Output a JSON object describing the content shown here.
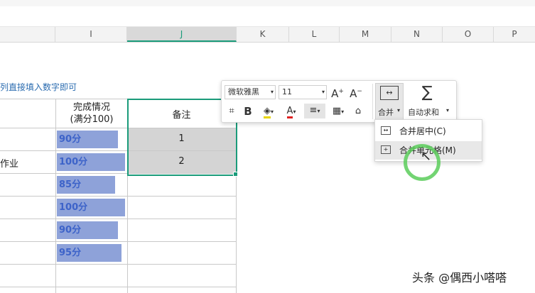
{
  "columns": [
    {
      "letter": "I",
      "selected": false
    },
    {
      "letter": "J",
      "selected": true
    },
    {
      "letter": "K",
      "selected": false
    },
    {
      "letter": "L",
      "selected": false
    },
    {
      "letter": "M",
      "selected": false
    },
    {
      "letter": "N",
      "selected": false
    },
    {
      "letter": "O",
      "selected": false
    },
    {
      "letter": "P",
      "selected": false
    }
  ],
  "sheet": {
    "note_text": "列直接填入数字即可",
    "header_completion": "完成情况\n(满分100)",
    "header_remark": "备注",
    "row_fragment": "作业",
    "scores": [
      "90分",
      "100分",
      "85分",
      "100分",
      "90分",
      "95分"
    ],
    "score_values": [
      90,
      100,
      85,
      100,
      90,
      95
    ],
    "remarks": [
      "1",
      "2"
    ]
  },
  "toolbar": {
    "font_name": "微软雅黑",
    "font_size": "11",
    "merge_label": "合并",
    "autosum_label": "自动求和"
  },
  "merge_menu": {
    "items": [
      {
        "label": "合并居中(C)",
        "icon": "merge-center-icon"
      },
      {
        "label": "合并单元格(M)",
        "icon": "merge-cells-icon"
      }
    ]
  },
  "watermark": "头条 @偶西小嗒嗒",
  "colors": {
    "accent": "#1a9b7a",
    "data_bar": "#8ea2d9",
    "data_bar_text": "#3d63c9"
  }
}
